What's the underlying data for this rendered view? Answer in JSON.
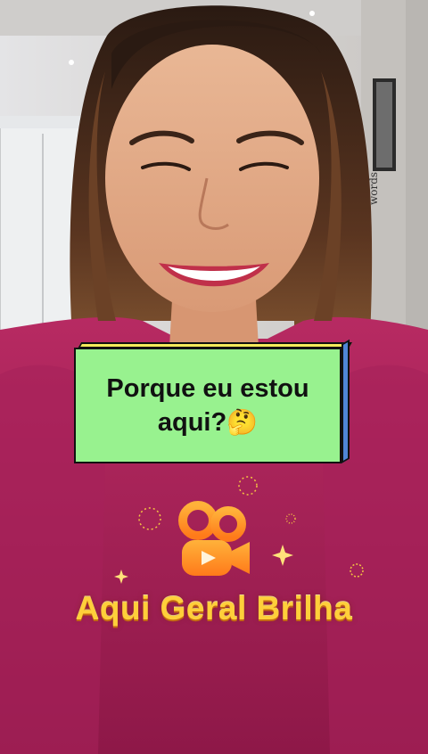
{
  "caption": {
    "line1": "Porque eu estou",
    "line2": "aqui?",
    "emoji": "🤔"
  },
  "branding": {
    "logo": "kwai-camera-logo-icon",
    "tagline": "Aqui Geral Brilha"
  },
  "colors": {
    "caption_bg": "#98f28f",
    "caption_depth_side": "#4f86d6",
    "caption_depth_top": "#f4ea5a",
    "tagline": "#ffcf3a",
    "shirt": "#b0245c"
  }
}
